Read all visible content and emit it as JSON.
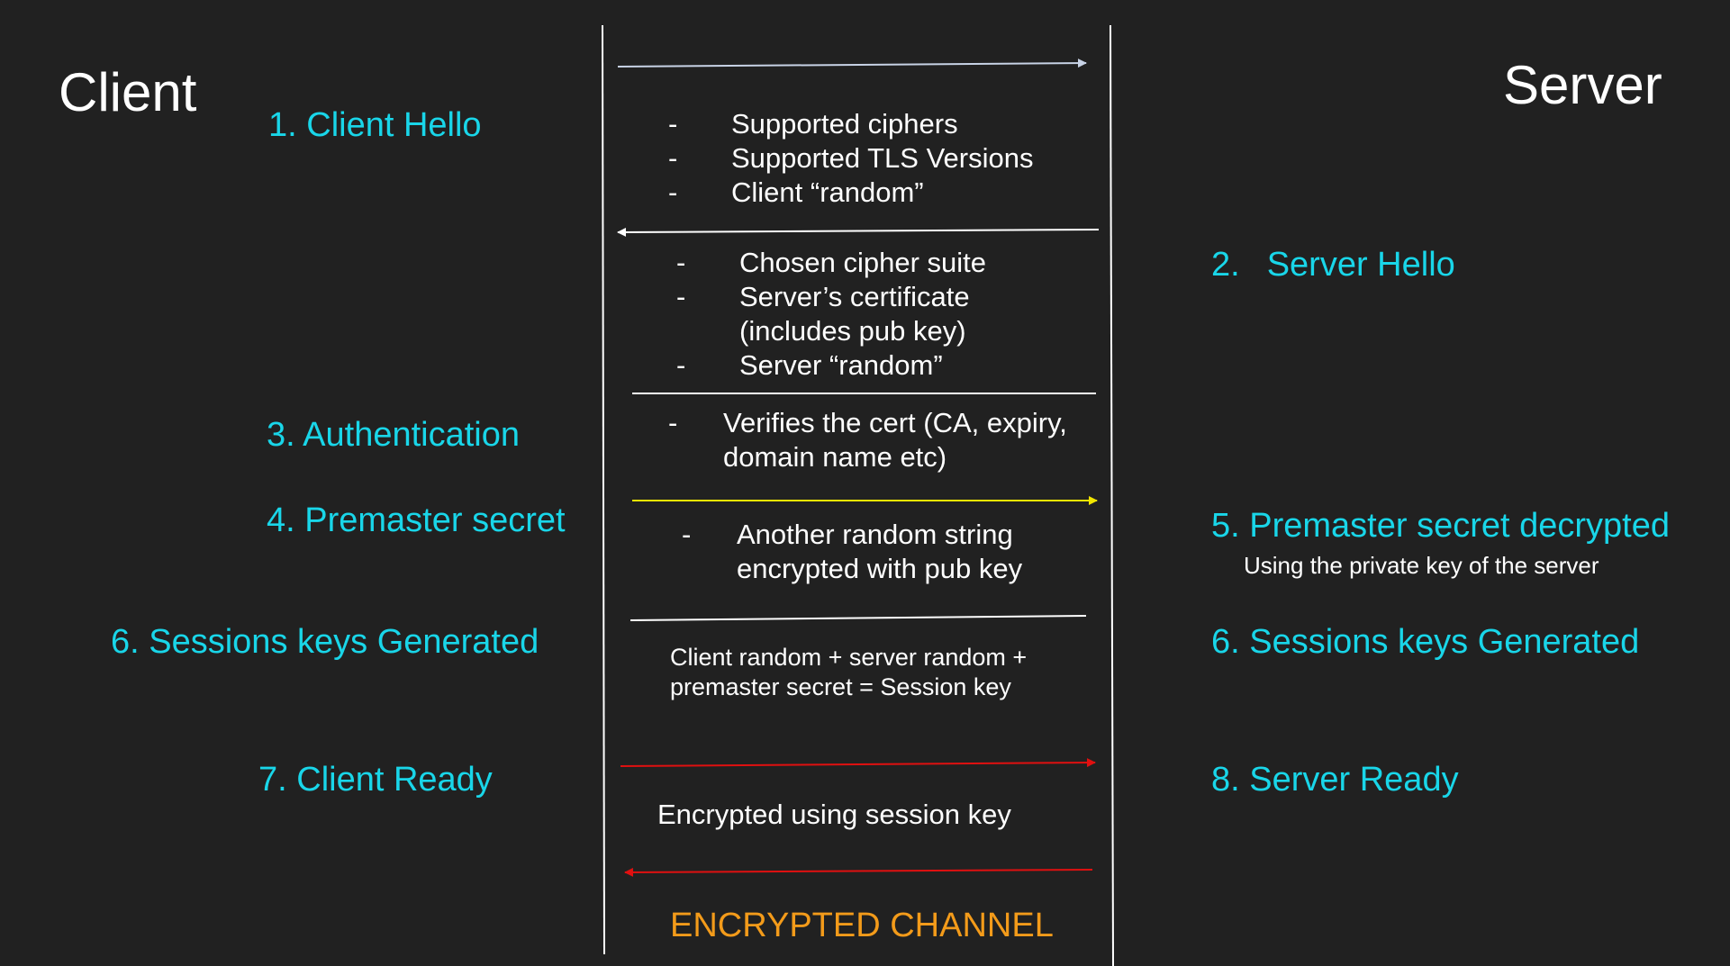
{
  "actors": {
    "client": "Client",
    "server": "Server"
  },
  "steps": {
    "client_hello": "1. Client Hello",
    "server_hello_num": "2.",
    "server_hello_text": "Server Hello",
    "authentication": "3. Authentication",
    "premaster_secret": "4. Premaster secret",
    "premaster_decrypted": "5. Premaster secret decrypted",
    "premaster_decrypted_note": "Using the private key of the server",
    "client_session_keys": "6. Sessions keys Generated",
    "server_session_keys": "6. Sessions keys Generated",
    "client_ready": "7. Client Ready",
    "server_ready": "8. Server Ready"
  },
  "messages": {
    "client_hello": [
      "Supported ciphers",
      "Supported TLS Versions",
      "Client “random”"
    ],
    "server_hello": [
      "Chosen cipher suite",
      "Server’s certificate",
      "(includes pub key)",
      "Server “random”"
    ],
    "authentication": [
      "Verifies the cert (CA, expiry,",
      "domain name etc)"
    ],
    "premaster": [
      "Another random string",
      "encrypted with pub key"
    ],
    "session_key": [
      "Client random + server random +",
      "premaster secret = Session key"
    ],
    "encrypted": "Encrypted using session key",
    "dash": "-"
  },
  "channel_label": "ENCRYPTED CHANNEL",
  "colors": {
    "background": "#212121",
    "step_text": "#19d6e9",
    "channel_text": "#f39b1a",
    "arrow_light": "#c8d3e6",
    "arrow_yellow": "#f2e600",
    "arrow_red": "#e01010"
  }
}
